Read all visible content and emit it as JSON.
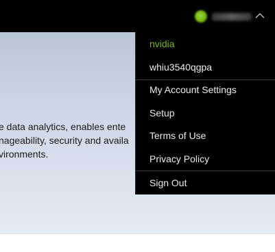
{
  "header": {
    "user_menu": {
      "avatar_icon": "user-avatar-icon",
      "expanded": true,
      "chevron_icon": "chevron-up-icon"
    }
  },
  "hero": {
    "lines": [
      "e data analytics, enables ente",
      "nageability, security and availa",
      "vironments."
    ]
  },
  "dropdown": {
    "org_name": "nvidia",
    "account_id": "whiu3540qgpa",
    "items": [
      "My Account Settings",
      "Setup",
      "Terms of Use",
      "Privacy Policy"
    ],
    "sign_out": "Sign Out"
  },
  "colors": {
    "accent": "#76b900",
    "menu_bg": "#000000",
    "menu_text": "#eaeaea"
  }
}
